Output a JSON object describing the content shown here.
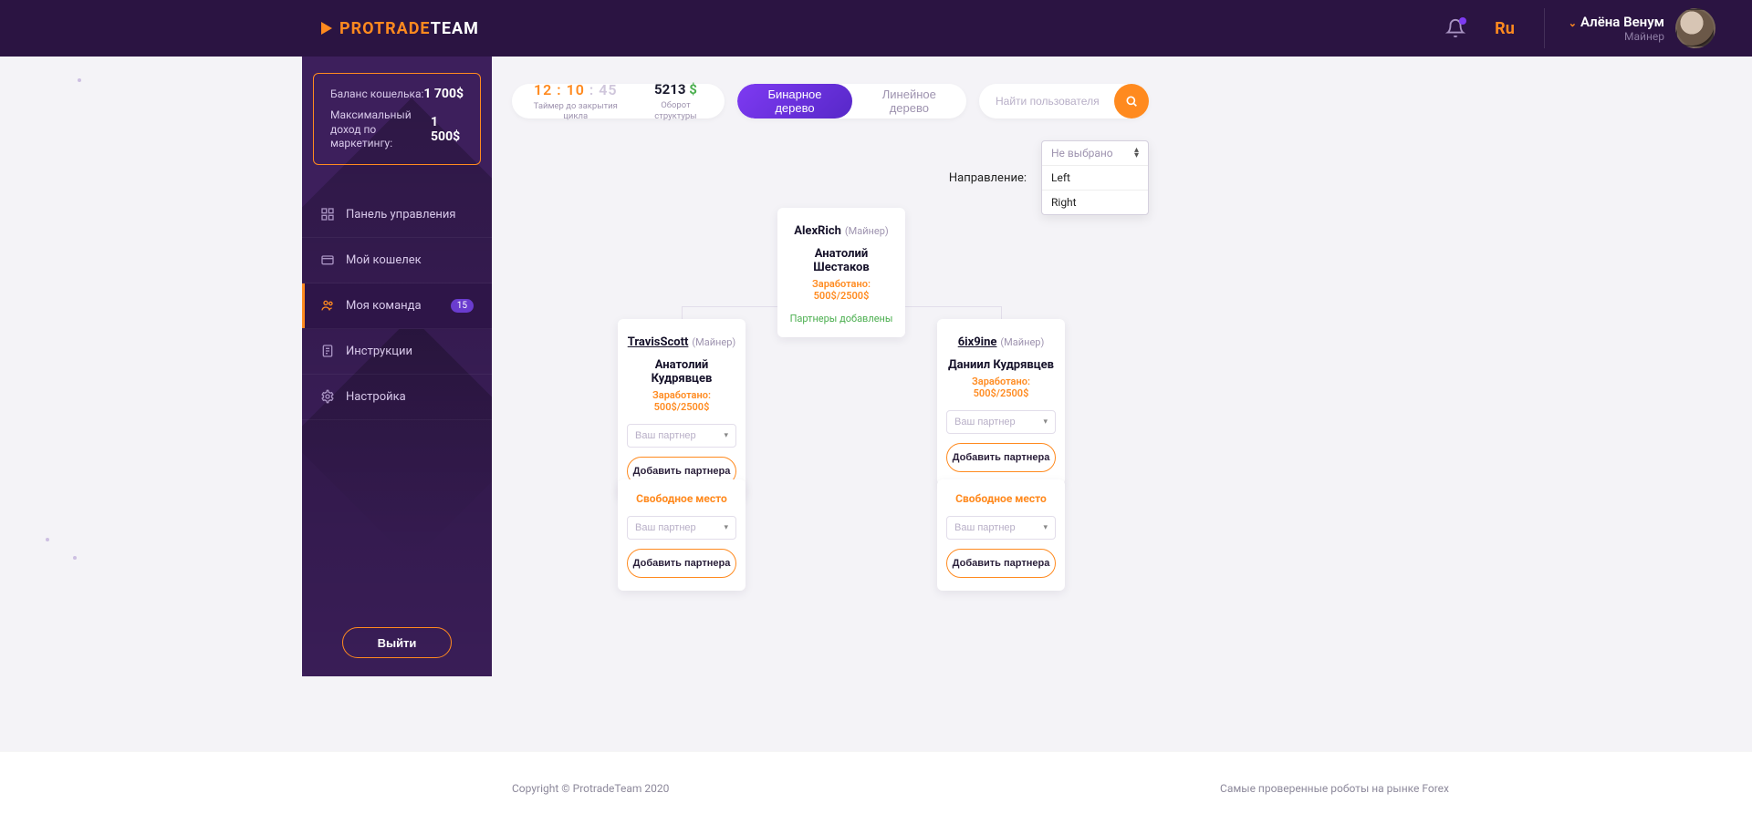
{
  "brand": {
    "a": "PROTRADE",
    "b": "TEAM"
  },
  "header": {
    "lang": "Ru",
    "user_name": "Алёна Венум",
    "user_role": "Майнер"
  },
  "balance": {
    "wallet_label": "Баланс кошелька:",
    "wallet_value": "1 700$",
    "marketing_label": "Максимальный доход по маркетингу:",
    "marketing_value": "1 500$"
  },
  "nav": {
    "dashboard": "Панель управления",
    "wallet": "Мой кошелек",
    "team": "Моя команда",
    "team_badge": "15",
    "instructions": "Инструкции",
    "settings": "Настройка",
    "logout": "Выйти"
  },
  "controls": {
    "timer_value": "12 : 10",
    "timer_seconds": " : 45",
    "timer_label": "Таймер до закрытия цикла",
    "turnover_value": "5213 ",
    "turnover_currency": "$",
    "turnover_label": "Оборот структуры",
    "tab_binary": "Бинарное дерево",
    "tab_linear": "Линейное дерево",
    "search_placeholder": "Найти пользователя"
  },
  "direction": {
    "label": "Направление:",
    "placeholder": "Не выбрано",
    "opt_left": "Left",
    "opt_right": "Right"
  },
  "tree": {
    "role": "(Майнер)",
    "earn_label": "Заработано: ",
    "earn_value": "500$/2500$",
    "root": {
      "username": "AlexRich",
      "fullname": "Анатолий Шестаков",
      "partners_added": "Партнеры добавлены"
    },
    "left": {
      "username": "TravisScott",
      "fullname": "Анатолий Кудрявцев"
    },
    "right": {
      "username": "6ix9ine",
      "fullname": "Даниил Кудрявцев"
    },
    "free_label": "Свободное место",
    "partner_placeholder": "Ваш партнер",
    "add_button": "Добавить партнера"
  },
  "footer": {
    "left": "Copyright © ProtradeTeam 2020",
    "right": "Самые проверенные роботы на рынке Forex"
  }
}
